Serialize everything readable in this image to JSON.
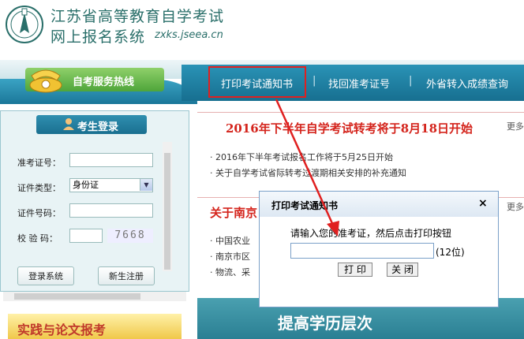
{
  "header": {
    "title_line1": "江苏省高等教育自学考试",
    "title_line2": "网上报名系统",
    "url": "zxks.jseea.cn",
    "logo_icon": "emblem-icon"
  },
  "hotline": {
    "label": "自考服务热线",
    "icon": "telephone-icon"
  },
  "nav": {
    "items": [
      "打印考试通知书",
      "找回准考证号",
      "外省转入成绩查询"
    ],
    "separator": "|",
    "highlight_color": "#e02020"
  },
  "login": {
    "title": "考生登录",
    "fields": {
      "ticket_label": "准考证号：",
      "id_type_label": "证件类型：",
      "id_type_value": "身份证",
      "id_number_label": "证件号码：",
      "captcha_label": "校 验 码：",
      "captcha_text": "7668"
    },
    "login_button": "登录系统",
    "register_button": "新生注册"
  },
  "practice_banner": "实践与论文报考",
  "news1": {
    "title": "2016年下半年自学考试转考将于8月18日开始",
    "more": "更多",
    "items": [
      "2016年下半年考试报名工作将于5月25日开始",
      "关于自学考试省际转考过渡期相关安排的补充通知"
    ]
  },
  "news2": {
    "title": "关于南京",
    "more": "更多",
    "items": [
      "中国农业",
      "南京市区",
      "物流、采"
    ]
  },
  "bottom_banner": "提高学历层次",
  "dialog": {
    "title": "打印考试通知书",
    "close": "×",
    "prompt": "请输入您的准考证，然后点击打印按钮",
    "input_value": "",
    "hint": "(12位)",
    "print_button": "打 印",
    "close_button": "关 闭"
  },
  "annotation_color": "#e02020"
}
